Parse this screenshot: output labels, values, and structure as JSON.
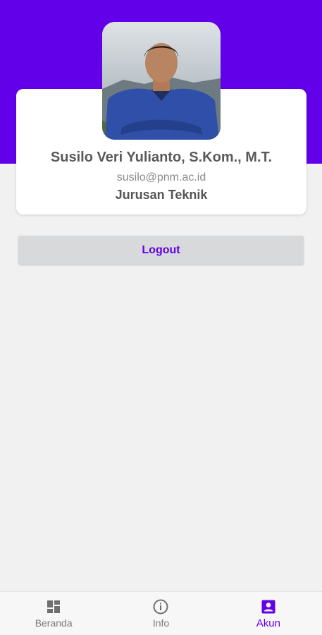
{
  "colors": {
    "primary": "#6200ea",
    "background": "#f1f1f1",
    "card": "#ffffff",
    "button_bg": "#d8d9da",
    "inactive_icon": "#6f6f6f"
  },
  "profile": {
    "avatar_icon": "profile-photo",
    "name": "Susilo Veri Yulianto, S.Kom., M.T.",
    "email": "susilo@pnm.ac.id",
    "department": "Jurusan Teknik"
  },
  "actions": {
    "logout_label": "Logout"
  },
  "bottom_nav": {
    "items": [
      {
        "label": "Beranda",
        "icon": "dashboard-icon",
        "active": false
      },
      {
        "label": "Info",
        "icon": "info-icon",
        "active": false
      },
      {
        "label": "Akun",
        "icon": "account-box-icon",
        "active": true
      }
    ]
  }
}
